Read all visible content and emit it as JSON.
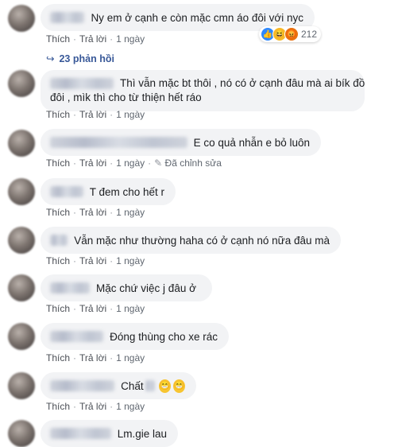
{
  "actions": {
    "like": "Thích",
    "reply": "Trả lời"
  },
  "comments": [
    {
      "text": "Ny em ở cạnh e còn mặc cmn áo đôi với nyc",
      "time": "1 ngày",
      "reactions": "212"
    },
    {
      "text_line1": "Thì vẫn mặc bt thôi , nó có ở cạnh đâu mà ai bík đồ",
      "text_line2": "đôi , mìk thì cho từ thiện hết ráo",
      "time": "1 ngày"
    },
    {
      "text": "E co quả nhẫn e bỏ luôn",
      "time": "1 ngày",
      "edited": "Đã chỉnh sửa"
    },
    {
      "text": "T đem cho hết r",
      "time": "1 ngày"
    },
    {
      "text": "Vẫn mặc như thường haha có ở cạnh nó nữa đâu mà",
      "time": "1 ngày"
    },
    {
      "text": "Mặc chứ việc j đâu ở",
      "time": "1 ngày"
    },
    {
      "text": "Đóng thùng cho xe rác",
      "time": "1 ngày"
    },
    {
      "text": "Chất",
      "time": "1 ngày"
    },
    {
      "text": "Lm.gie lau"
    }
  ],
  "replies_label": "23 phản hồi",
  "icons": {
    "reaction_like": "like-icon",
    "reaction_haha": "haha-icon",
    "reaction_angry": "angry-icon",
    "replies": "reply-arrow-icon",
    "emoji": "grinning-face-icon",
    "edit": "pencil-icon"
  }
}
